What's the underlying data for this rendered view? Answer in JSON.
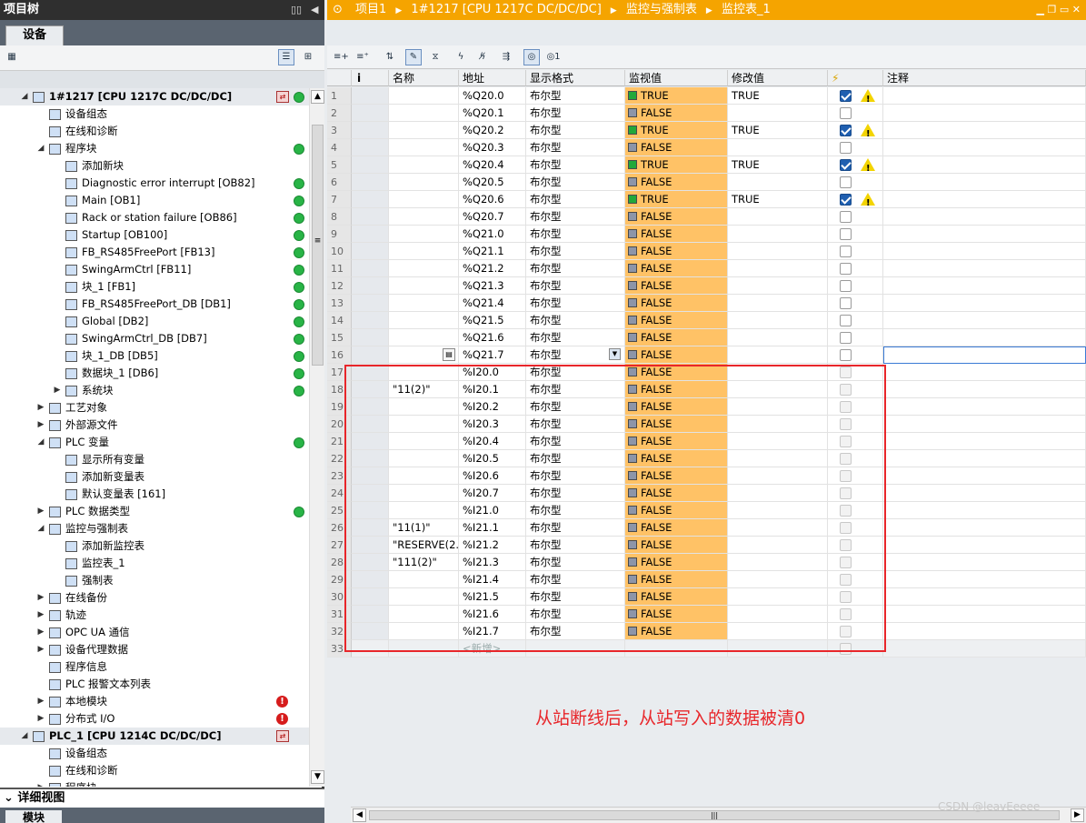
{
  "left": {
    "title": "项目树",
    "tab": "设备",
    "detail_title": "详细视图",
    "detail_tab": "模块",
    "tree": [
      {
        "label": "1#1217 [CPU 1217C DC/DC/DC]",
        "level": 0,
        "arrow": "down",
        "icon": "plc-icon",
        "status": "green",
        "sel": true,
        "dev": true
      },
      {
        "label": "设备组态",
        "level": 1,
        "arrow": "",
        "icon": "device-config-icon"
      },
      {
        "label": "在线和诊断",
        "level": 1,
        "arrow": "",
        "icon": "online-diagnostics-icon"
      },
      {
        "label": "程序块",
        "level": 1,
        "arrow": "down",
        "icon": "folder-icon",
        "status": "green"
      },
      {
        "label": "添加新块",
        "level": 2,
        "arrow": "",
        "icon": "add-block-icon"
      },
      {
        "label": "Diagnostic error interrupt [OB82]",
        "level": 2,
        "arrow": "",
        "icon": "ob-icon",
        "status": "green"
      },
      {
        "label": "Main [OB1]",
        "level": 2,
        "arrow": "",
        "icon": "ob-icon",
        "status": "green"
      },
      {
        "label": "Rack or station failure [OB86]",
        "level": 2,
        "arrow": "",
        "icon": "ob-icon",
        "status": "green"
      },
      {
        "label": "Startup [OB100]",
        "level": 2,
        "arrow": "",
        "icon": "ob-icon",
        "status": "green"
      },
      {
        "label": "FB_RS485FreePort [FB13]",
        "level": 2,
        "arrow": "",
        "icon": "fb-icon",
        "status": "green"
      },
      {
        "label": "SwingArmCtrl [FB11]",
        "level": 2,
        "arrow": "",
        "icon": "fb-icon",
        "status": "green"
      },
      {
        "label": "块_1 [FB1]",
        "level": 2,
        "arrow": "",
        "icon": "fb-icon",
        "status": "green"
      },
      {
        "label": "FB_RS485FreePort_DB [DB1]",
        "level": 2,
        "arrow": "",
        "icon": "db-icon",
        "status": "green"
      },
      {
        "label": "Global [DB2]",
        "level": 2,
        "arrow": "",
        "icon": "db-icon",
        "status": "green"
      },
      {
        "label": "SwingArmCtrl_DB [DB7]",
        "level": 2,
        "arrow": "",
        "icon": "db-icon",
        "status": "green"
      },
      {
        "label": "块_1_DB [DB5]",
        "level": 2,
        "arrow": "",
        "icon": "db-icon",
        "status": "green"
      },
      {
        "label": "数据块_1 [DB6]",
        "level": 2,
        "arrow": "",
        "icon": "db-icon",
        "status": "green"
      },
      {
        "label": "系统块",
        "level": 2,
        "arrow": "right",
        "icon": "system-block-icon",
        "status": "green"
      },
      {
        "label": "工艺对象",
        "level": 1,
        "arrow": "right",
        "icon": "technology-object-icon"
      },
      {
        "label": "外部源文件",
        "level": 1,
        "arrow": "right",
        "icon": "external-source-icon"
      },
      {
        "label": "PLC 变量",
        "level": 1,
        "arrow": "down",
        "icon": "plc-tags-icon",
        "status": "green"
      },
      {
        "label": "显示所有变量",
        "level": 2,
        "arrow": "",
        "icon": "show-tags-icon"
      },
      {
        "label": "添加新变量表",
        "level": 2,
        "arrow": "",
        "icon": "add-tag-table-icon"
      },
      {
        "label": "默认变量表 [161]",
        "level": 2,
        "arrow": "",
        "icon": "tag-table-icon"
      },
      {
        "label": "PLC 数据类型",
        "level": 1,
        "arrow": "right",
        "icon": "data-type-icon",
        "status": "green"
      },
      {
        "label": "监控与强制表",
        "level": 1,
        "arrow": "down",
        "icon": "watch-folder-icon"
      },
      {
        "label": "添加新监控表",
        "level": 2,
        "arrow": "",
        "icon": "add-watch-table-icon"
      },
      {
        "label": "监控表_1",
        "level": 2,
        "arrow": "",
        "icon": "watch-table-icon"
      },
      {
        "label": "强制表",
        "level": 2,
        "arrow": "",
        "icon": "force-table-icon"
      },
      {
        "label": "在线备份",
        "level": 1,
        "arrow": "right",
        "icon": "online-backup-icon"
      },
      {
        "label": "轨迹",
        "level": 1,
        "arrow": "right",
        "icon": "trace-icon"
      },
      {
        "label": "OPC UA 通信",
        "level": 1,
        "arrow": "right",
        "icon": "opc-ua-icon"
      },
      {
        "label": "设备代理数据",
        "level": 1,
        "arrow": "right",
        "icon": "proxy-data-icon"
      },
      {
        "label": "程序信息",
        "level": 1,
        "arrow": "",
        "icon": "program-info-icon"
      },
      {
        "label": "PLC 报警文本列表",
        "level": 1,
        "arrow": "",
        "icon": "alarm-text-icon"
      },
      {
        "label": "本地模块",
        "level": 1,
        "arrow": "right",
        "icon": "local-modules-icon",
        "status": "error"
      },
      {
        "label": "分布式 I/O",
        "level": 1,
        "arrow": "right",
        "icon": "distributed-io-icon",
        "status": "error"
      },
      {
        "label": "PLC_1 [CPU 1214C DC/DC/DC]",
        "level": 0,
        "arrow": "down",
        "icon": "plc-icon",
        "sel": true,
        "dev2": true
      },
      {
        "label": "设备组态",
        "level": 1,
        "arrow": "",
        "icon": "device-config-icon"
      },
      {
        "label": "在线和诊断",
        "level": 1,
        "arrow": "",
        "icon": "online-diagnostics-icon"
      },
      {
        "label": "程序块",
        "level": 1,
        "arrow": "right",
        "icon": "folder-icon"
      }
    ]
  },
  "breadcrumb": [
    "项目1",
    "1#1217 [CPU 1217C DC/DC/DC]",
    "监控与强制表",
    "监控表_1"
  ],
  "table": {
    "headers": {
      "i": "i",
      "name": "名称",
      "addr": "地址",
      "fmt": "显示格式",
      "mon": "监视值",
      "mod": "修改值",
      "chk": "⚡",
      "cmt": "注释"
    },
    "rows": [
      {
        "n": "1",
        "name": "",
        "addr": "%Q20.0",
        "fmt": "布尔型",
        "mon": "TRUE",
        "mod": "TRUE",
        "chk": "on"
      },
      {
        "n": "2",
        "name": "",
        "addr": "%Q20.1",
        "fmt": "布尔型",
        "mon": "FALSE",
        "mod": "",
        "chk": "off"
      },
      {
        "n": "3",
        "name": "",
        "addr": "%Q20.2",
        "fmt": "布尔型",
        "mon": "TRUE",
        "mod": "TRUE",
        "chk": "on"
      },
      {
        "n": "4",
        "name": "",
        "addr": "%Q20.3",
        "fmt": "布尔型",
        "mon": "FALSE",
        "mod": "",
        "chk": "off"
      },
      {
        "n": "5",
        "name": "",
        "addr": "%Q20.4",
        "fmt": "布尔型",
        "mon": "TRUE",
        "mod": "TRUE",
        "chk": "on"
      },
      {
        "n": "6",
        "name": "",
        "addr": "%Q20.5",
        "fmt": "布尔型",
        "mon": "FALSE",
        "mod": "",
        "chk": "off"
      },
      {
        "n": "7",
        "name": "",
        "addr": "%Q20.6",
        "fmt": "布尔型",
        "mon": "TRUE",
        "mod": "TRUE",
        "chk": "on"
      },
      {
        "n": "8",
        "name": "",
        "addr": "%Q20.7",
        "fmt": "布尔型",
        "mon": "FALSE",
        "mod": "",
        "chk": "off"
      },
      {
        "n": "9",
        "name": "",
        "addr": "%Q21.0",
        "fmt": "布尔型",
        "mon": "FALSE",
        "mod": "",
        "chk": "off"
      },
      {
        "n": "10",
        "name": "",
        "addr": "%Q21.1",
        "fmt": "布尔型",
        "mon": "FALSE",
        "mod": "",
        "chk": "off"
      },
      {
        "n": "11",
        "name": "",
        "addr": "%Q21.2",
        "fmt": "布尔型",
        "mon": "FALSE",
        "mod": "",
        "chk": "off"
      },
      {
        "n": "12",
        "name": "",
        "addr": "%Q21.3",
        "fmt": "布尔型",
        "mon": "FALSE",
        "mod": "",
        "chk": "off"
      },
      {
        "n": "13",
        "name": "",
        "addr": "%Q21.4",
        "fmt": "布尔型",
        "mon": "FALSE",
        "mod": "",
        "chk": "off"
      },
      {
        "n": "14",
        "name": "",
        "addr": "%Q21.5",
        "fmt": "布尔型",
        "mon": "FALSE",
        "mod": "",
        "chk": "off"
      },
      {
        "n": "15",
        "name": "",
        "addr": "%Q21.6",
        "fmt": "布尔型",
        "mon": "FALSE",
        "mod": "",
        "chk": "off"
      },
      {
        "n": "16",
        "name": "",
        "addr": "%Q21.7",
        "fmt": "布尔型",
        "mon": "FALSE",
        "mod": "",
        "chk": "off",
        "active": true
      },
      {
        "n": "17",
        "name": "",
        "addr": "%I20.0",
        "fmt": "布尔型",
        "mon": "FALSE",
        "mod": "",
        "chk": "dis",
        "gray": true
      },
      {
        "n": "18",
        "name": "\"11(2)\"",
        "addr": "%I20.1",
        "fmt": "布尔型",
        "mon": "FALSE",
        "mod": "",
        "chk": "dis",
        "gray": true
      },
      {
        "n": "19",
        "name": "",
        "addr": "%I20.2",
        "fmt": "布尔型",
        "mon": "FALSE",
        "mod": "",
        "chk": "dis",
        "gray": true
      },
      {
        "n": "20",
        "name": "",
        "addr": "%I20.3",
        "fmt": "布尔型",
        "mon": "FALSE",
        "mod": "",
        "chk": "dis",
        "gray": true
      },
      {
        "n": "21",
        "name": "",
        "addr": "%I20.4",
        "fmt": "布尔型",
        "mon": "FALSE",
        "mod": "",
        "chk": "dis",
        "gray": true
      },
      {
        "n": "22",
        "name": "",
        "addr": "%I20.5",
        "fmt": "布尔型",
        "mon": "FALSE",
        "mod": "",
        "chk": "dis",
        "gray": true
      },
      {
        "n": "23",
        "name": "",
        "addr": "%I20.6",
        "fmt": "布尔型",
        "mon": "FALSE",
        "mod": "",
        "chk": "dis",
        "gray": true
      },
      {
        "n": "24",
        "name": "",
        "addr": "%I20.7",
        "fmt": "布尔型",
        "mon": "FALSE",
        "mod": "",
        "chk": "dis",
        "gray": true
      },
      {
        "n": "25",
        "name": "",
        "addr": "%I21.0",
        "fmt": "布尔型",
        "mon": "FALSE",
        "mod": "",
        "chk": "dis",
        "gray": true
      },
      {
        "n": "26",
        "name": "\"11(1)\"",
        "addr": "%I21.1",
        "fmt": "布尔型",
        "mon": "FALSE",
        "mod": "",
        "chk": "dis",
        "gray": true
      },
      {
        "n": "27",
        "name": "\"RESERVE(2...",
        "addr": "%I21.2",
        "fmt": "布尔型",
        "mon": "FALSE",
        "mod": "",
        "chk": "dis",
        "gray": true
      },
      {
        "n": "28",
        "name": "\"111(2)\"",
        "addr": "%I21.3",
        "fmt": "布尔型",
        "mon": "FALSE",
        "mod": "",
        "chk": "dis",
        "gray": true
      },
      {
        "n": "29",
        "name": "",
        "addr": "%I21.4",
        "fmt": "布尔型",
        "mon": "FALSE",
        "mod": "",
        "chk": "dis",
        "gray": true
      },
      {
        "n": "30",
        "name": "",
        "addr": "%I21.5",
        "fmt": "布尔型",
        "mon": "FALSE",
        "mod": "",
        "chk": "dis",
        "gray": true
      },
      {
        "n": "31",
        "name": "",
        "addr": "%I21.6",
        "fmt": "布尔型",
        "mon": "FALSE",
        "mod": "",
        "chk": "dis",
        "gray": true
      },
      {
        "n": "32",
        "name": "",
        "addr": "%I21.7",
        "fmt": "布尔型",
        "mon": "FALSE",
        "mod": "",
        "chk": "dis",
        "gray": true
      }
    ],
    "new_row": {
      "n": "33",
      "label": "<新增>"
    }
  },
  "annotation": "从站断线后，从站写入的数据被清0",
  "watermark": "CSDN @leavEeeee",
  "colors": {
    "title_bar": "#f5a400",
    "monitor_cell": "#ffc266",
    "true_indicator": "#22a83a",
    "false_indicator": "#8d95a8",
    "status_ok": "#28b446",
    "status_error": "#d61c1c",
    "highlight_box": "#e8262a"
  }
}
